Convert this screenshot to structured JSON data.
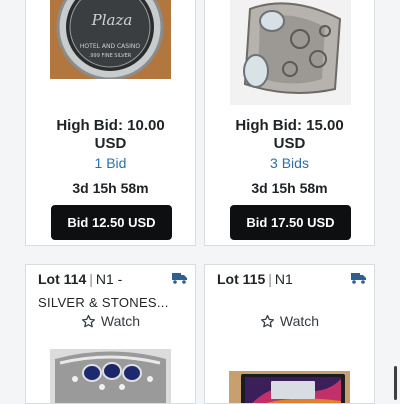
{
  "colors": {
    "bid_button": "#0d0f11",
    "bids_link": "#2f6fa8",
    "truck_icon": "#2f5f8f",
    "card_border": "#d9dde1"
  },
  "lots_top": [
    {
      "high_bid": "High Bid: 10.00",
      "currency": "USD",
      "bids": "1 Bid",
      "time_left": "3d 15h 58m",
      "bid_button": "Bid 12.50 USD",
      "image_icon": "coin-token-image"
    },
    {
      "high_bid": "High Bid: 15.00",
      "currency": "USD",
      "bids": "3 Bids",
      "time_left": "3d 15h 58m",
      "bid_button": "Bid 17.50 USD",
      "image_icon": "silver-ring-image"
    }
  ],
  "lots_bottom": [
    {
      "lot": "Lot 114",
      "category": "N1 -",
      "title": "SILVER & STONES...",
      "watch": "Watch",
      "image_icon": "sapphire-ring-image"
    },
    {
      "lot": "Lot 115",
      "category": "N1",
      "title": "",
      "watch": "Watch",
      "image_icon": "laptop-image"
    }
  ]
}
